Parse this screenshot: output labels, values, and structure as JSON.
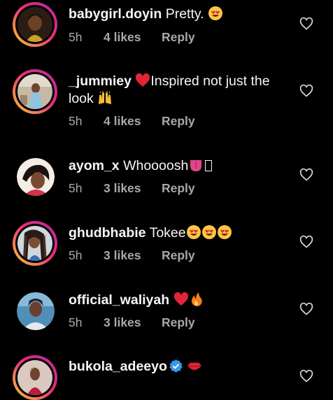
{
  "comments": [
    {
      "username": "babygirl.doyin",
      "text": "Pretty.",
      "time": "5h",
      "likes": "4 likes",
      "reply": "Reply",
      "emoji": [
        "heart-eyes-icon"
      ]
    },
    {
      "username": "_jummiey",
      "text_part1": "Inspired not just the",
      "text_part2": "look",
      "time": "5h",
      "likes": "4 likes",
      "reply": "Reply",
      "emoji": [
        "red-heart-icon",
        "raising-hands-icon"
      ]
    },
    {
      "username": "ayom_x",
      "text": "Whoooosh",
      "time": "5h",
      "likes": "3 likes",
      "reply": "Reply",
      "emoji": [
        "tongue-icon",
        "unknown-glyph-icon"
      ]
    },
    {
      "username": "ghudbhabie",
      "text": "Tokee",
      "time": "5h",
      "likes": "3 likes",
      "reply": "Reply",
      "emoji": [
        "heart-eyes-icon",
        "heart-eyes-icon",
        "heart-eyes-icon"
      ]
    },
    {
      "username": "official_waliyah",
      "text": "",
      "time": "5h",
      "likes": "3 likes",
      "reply": "Reply",
      "emoji": [
        "red-heart-icon",
        "fire-icon"
      ]
    },
    {
      "username": "bukola_adeeyo",
      "text": "",
      "verified": true,
      "emoji": [
        "verified-badge-icon",
        "kiss-lips-icon"
      ]
    }
  ],
  "colors": {
    "background": "#000000",
    "primary_text": "#f5f5f5",
    "secondary_text": "#a8a8a8",
    "story_ring_start": "#f9ce34",
    "story_ring_end": "#b02aa3",
    "verified_blue": "#3897f0"
  }
}
